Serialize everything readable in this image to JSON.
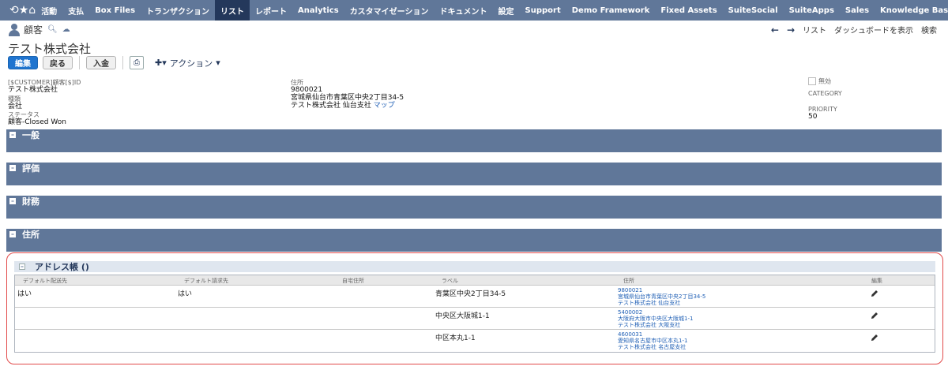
{
  "nav": {
    "items": [
      "活動",
      "支払",
      "Box Files",
      "トランザクション",
      "リスト",
      "レポート",
      "Analytics",
      "カスタマイゼーション",
      "ドキュメント",
      "設定",
      "Support",
      "Demo Framework",
      "Fixed Assets",
      "SuiteSocial",
      "SuiteApps",
      "Sales",
      "Knowledge Base"
    ],
    "active": "リスト"
  },
  "record": {
    "type_label": "顧客",
    "title": "テスト株式会社"
  },
  "right_nav": {
    "list": "リスト",
    "dashboard": "ダッシュボードを表示",
    "search": "検索"
  },
  "toolbar": {
    "edit": "編集",
    "back": "戻る",
    "payment": "入金",
    "action": "アクション"
  },
  "fields": {
    "customer_id_label": "[$CUSTOMER]顧客[$]ID",
    "customer_id_value": "テスト株式会社",
    "type_label": "種類",
    "type_value": "会社",
    "status_label": "ステータス",
    "status_value": "顧客-Closed Won",
    "address_label": "住所",
    "address_line1": "9800021",
    "address_line2": "宮城県仙台市青葉区中央2丁目34-5",
    "address_line3": "テスト株式会社 仙台支社",
    "map_link": "マップ",
    "inactive_label": "無効",
    "category_label": "CATEGORY",
    "priority_label": "PRIORITY",
    "priority_value": "50"
  },
  "sections": {
    "general": "一般",
    "evaluation": "評価",
    "finance": "財務",
    "address": "住所"
  },
  "address_book": {
    "title": "アドレス帳 ()",
    "columns": [
      "デフォルト配送先",
      "デフォルト請求先",
      "自宅住所",
      "ラベル",
      "住所",
      "編集"
    ],
    "rows": [
      {
        "ship": "はい",
        "bill": "はい",
        "label": "青葉区中央2丁目34-5",
        "zip": "9800021",
        "addr": "宮城県仙台市青葉区中央2丁目34-5",
        "name": "テスト株式会社 仙台支社"
      },
      {
        "ship": "",
        "bill": "",
        "label": "中央区大阪城1-1",
        "zip": "5400002",
        "addr": "大阪府大阪市中央区大阪城1-1",
        "name": "テスト株式会社 大阪支社"
      },
      {
        "ship": "",
        "bill": "",
        "label": "中区本丸1-1",
        "zip": "4600031",
        "addr": "愛知県名古屋市中区本丸1-1",
        "name": "テスト株式会社 名古屋支社"
      }
    ]
  }
}
